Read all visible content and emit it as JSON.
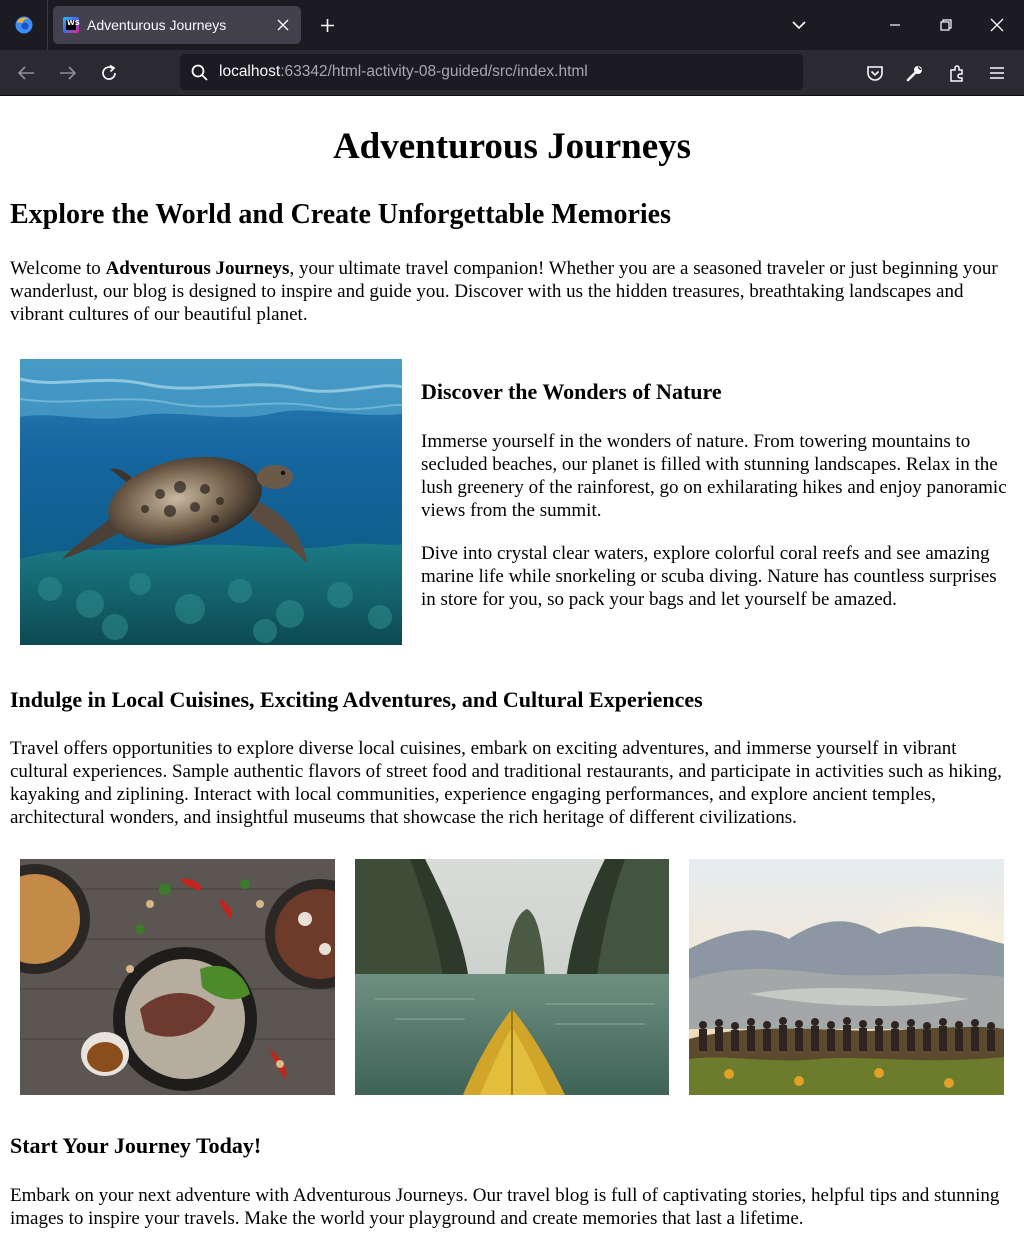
{
  "browser": {
    "tab": {
      "title": "Adventurous Journeys",
      "favicon": "ws-favicon-icon"
    },
    "url": {
      "host": "localhost",
      "rest": ":63342/html-activity-08-guided/src/index.html"
    },
    "icons": [
      "firefox-icon",
      "close-icon",
      "plus-icon",
      "chevron-down-icon",
      "minimize-icon",
      "restore-icon",
      "back-arrow-icon",
      "forward-arrow-icon",
      "reload-icon",
      "search-icon",
      "pocket-icon",
      "wrench-icon",
      "extensions-icon",
      "hamburger-menu-icon"
    ],
    "colors": {
      "tabbar": "#1c1b22",
      "navbar": "#2b2a33",
      "active_tab": "#42414d"
    }
  },
  "page": {
    "title": "Adventurous Journeys",
    "subtitle": "Explore the World and Create Unforgettable Memories",
    "intro": {
      "before": "Welcome to ",
      "bold": "Adventurous Journeys",
      "after": ", your ultimate travel companion! Whether you are a seasoned traveler or just beginning your wanderlust, our blog is designed to inspire and guide you. Discover with us the hidden treasures, breathtaking landscapes and vibrant cultures of our beautiful planet."
    },
    "nature": {
      "heading": "Discover the Wonders of Nature",
      "p1": "Immerse yourself in the wonders of nature. From towering mountains to secluded beaches, our planet is filled with stunning landscapes. Relax in the lush greenery of the rainforest, go on exhilarating hikes and enjoy panoramic views from the summit.",
      "p2": "Dive into crystal clear waters, explore colorful coral reefs and see amazing marine life while snorkeling or scuba diving. Nature has countless surprises in store for you, so pack your bags and let yourself be amazed."
    },
    "cuisine": {
      "heading": "Indulge in Local Cuisines, Exciting Adventures, and Cultural Experiences",
      "text": "Travel offers opportunities to explore diverse local cuisines, embark on exciting adventures, and immerse yourself in vibrant cultural experiences. Sample authentic flavors of street food and traditional restaurants, and participate in activities such as hiking, kayaking and ziplining. Interact with local communities, experience engaging performances, and explore ancient temples, architectural wonders, and insightful museums that showcase the rich heritage of different civilizations."
    },
    "journey": {
      "heading": "Start Your Journey Today!",
      "text": "Embark on your next adventure with Adventurous Journeys. Our travel blog is full of captivating stories, helpful tips and stunning images to inspire your travels. Make the world your playground and create memories that last a lifetime."
    }
  }
}
